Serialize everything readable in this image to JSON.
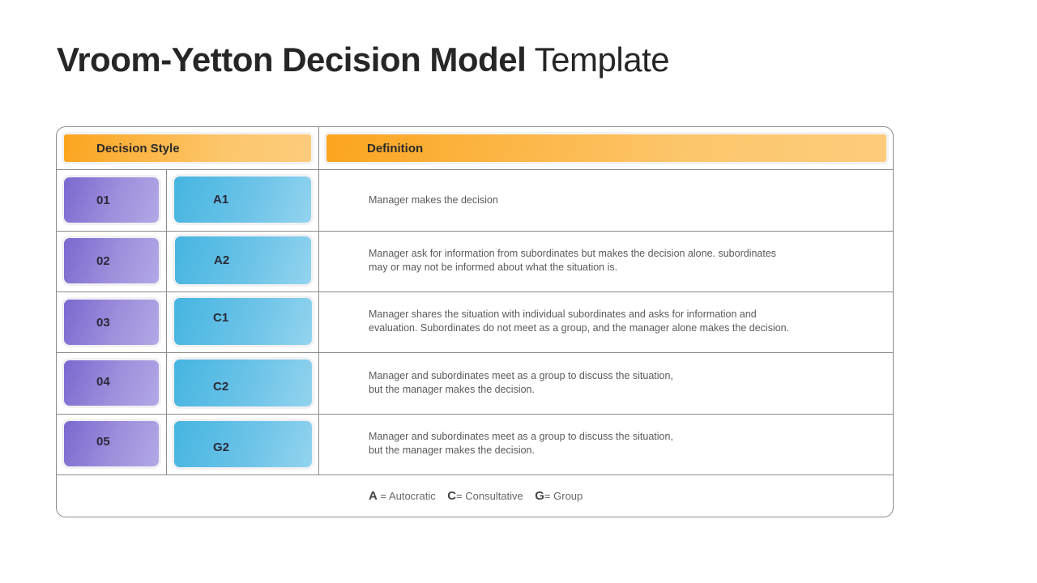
{
  "title": {
    "bold": "Vroom-Yetton Decision Model",
    "light": "Template"
  },
  "table": {
    "headers": {
      "style": "Decision Style",
      "definition": "Definition"
    },
    "rows": [
      {
        "num": "01",
        "code": "A1",
        "definition_lines": [
          "Manager makes the decision"
        ]
      },
      {
        "num": "02",
        "code": "A2",
        "definition_lines": [
          "Manager ask for information from subordinates but makes the decision alone. subordinates",
          "may or may not be informed about what the situation is."
        ]
      },
      {
        "num": "03",
        "code": "C1",
        "definition_lines": [
          "Manager shares the situation with individual subordinates and asks for information and",
          "evaluation. Subordinates do not meet as a group, and the manager alone makes the decision."
        ]
      },
      {
        "num": "04",
        "code": "C2",
        "definition_lines": [
          "Manager and subordinates meet as a  group to discuss  the situation,",
          "but the manager makes the decision."
        ]
      },
      {
        "num": "05",
        "code": "G2",
        "definition_lines": [
          "Manager and subordinates meet as a  group to discuss  the situation,",
          "but the manager makes the decision."
        ]
      }
    ],
    "legend": [
      {
        "key": "A",
        "value": " = Autocratic"
      },
      {
        "key": "C",
        "value": "= Consultative"
      },
      {
        "key": "G",
        "value": "= Group"
      }
    ]
  },
  "colors": {
    "header": "#fba51f",
    "number_pill": "#7b68cf",
    "code_pill": "#45b5e0",
    "title": "#262626"
  }
}
